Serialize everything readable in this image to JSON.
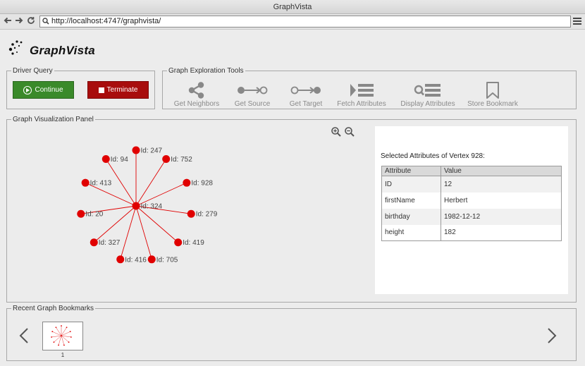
{
  "window": {
    "title": "GraphVista"
  },
  "browser": {
    "url": "http://localhost:4747/graphvista/"
  },
  "logo": {
    "text": "GraphVista"
  },
  "driver_query": {
    "legend": "Driver Query",
    "continue_label": "Continue",
    "terminate_label": "Terminate",
    "continue_color": "#3a8a2a",
    "terminate_color": "#a80d0d"
  },
  "tools": {
    "legend": "Graph Exploration Tools",
    "items": [
      {
        "label": "Get Neighbors",
        "icon": "share-icon"
      },
      {
        "label": "Get Source",
        "icon": "source-arrow-icon"
      },
      {
        "label": "Get Target",
        "icon": "target-arrow-icon"
      },
      {
        "label": "Fetch Attributes",
        "icon": "fetch-list-icon"
      },
      {
        "label": "Display Attributes",
        "icon": "search-list-icon"
      },
      {
        "label": "Store Bookmark",
        "icon": "bookmark-icon"
      }
    ]
  },
  "visualization": {
    "legend": "Graph Visualization Panel",
    "node_color": "#e00000",
    "center": {
      "label": "Id: 324"
    },
    "neighbors": [
      {
        "label": "Id: 247"
      },
      {
        "label": "Id: 752"
      },
      {
        "label": "Id: 928"
      },
      {
        "label": "Id: 279"
      },
      {
        "label": "Id: 419"
      },
      {
        "label": "Id: 705"
      },
      {
        "label": "Id: 416"
      },
      {
        "label": "Id: 327"
      },
      {
        "label": "Id: 20"
      },
      {
        "label": "Id: 413"
      },
      {
        "label": "Id: 94"
      }
    ]
  },
  "attributes": {
    "title": "Selected Attributes of Vertex 928:",
    "columns": [
      "Attribute",
      "Value"
    ],
    "rows": [
      {
        "attribute": "ID",
        "value": "12"
      },
      {
        "attribute": "firstName",
        "value": "Herbert"
      },
      {
        "attribute": "birthday",
        "value": "1982-12-12"
      },
      {
        "attribute": "height",
        "value": "182"
      }
    ]
  },
  "bookmarks": {
    "legend": "Recent Graph Bookmarks",
    "items": [
      {
        "label": "1"
      }
    ]
  }
}
